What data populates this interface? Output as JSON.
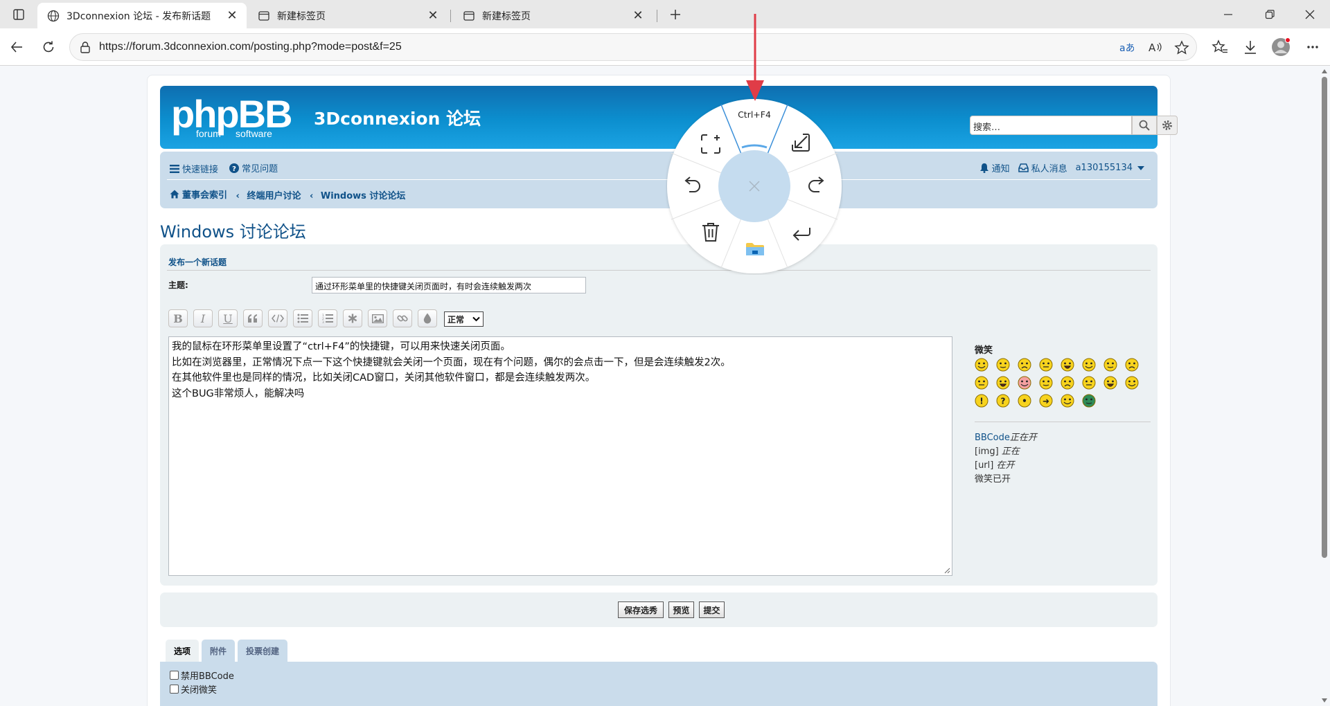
{
  "browser": {
    "tabs": [
      {
        "title": "3Dconnexion 论坛 - 发布新话题",
        "active": true
      },
      {
        "title": "新建标签页",
        "active": false
      },
      {
        "title": "新建标签页",
        "active": false
      }
    ],
    "url": "https://forum.3dconnexion.com/posting.php?mode=post&f=25"
  },
  "header": {
    "logo_text": "phpBB",
    "logo_sub1": "forum",
    "logo_sub2": "software",
    "site_title": "3Dconnexion 论坛",
    "search_placeholder": "搜索…"
  },
  "nav": {
    "quick_links": "快速链接",
    "faq": "常见问题",
    "notifications": "通知",
    "private_messages": "私人消息",
    "username": "a130155134",
    "breadcrumbs": [
      "董事会索引",
      "终端用户讨论",
      "Windows 讨论论坛"
    ]
  },
  "forum_title": "Windows 讨论论坛",
  "posting": {
    "panel_title": "发布一个新话题",
    "subject_label": "主题:",
    "subject_value": "通过环形菜单里的快捷键关闭页面时，有时会连续触发两次",
    "size_select": "正常",
    "message_lines": [
      "我的鼠标在环形菜单里设置了“ctrl+F4”的快捷键，可以用来快速关闭页面。",
      "比如在浏览器里，正常情况下点一下这个快捷键就会关闭一个页面，现在有个问题，偶尔的会点击一下，但是会连续触发2次。",
      "在其他软件里也是同样的情况，比如关闭CAD窗口，关闭其他软件窗口，都是会连续触发两次。",
      "这个BUG非常烦人，能解决吗"
    ],
    "smilies_title": "微笑",
    "bbcode_link": "BBCode",
    "bbcode_status": "正在开",
    "img_label": "[img]",
    "img_status": "正在",
    "url_label": "[url]",
    "url_status": "在开",
    "smilies_label": "微笑已开"
  },
  "buttons": {
    "save": "保存选秀",
    "preview": "预览",
    "submit": "提交"
  },
  "bottom_tabs": [
    "选项",
    "附件",
    "投票创建"
  ],
  "options": {
    "disable_bbcode": "禁用BBCode",
    "disable_smilies": "关闭微笑"
  },
  "radial_menu": {
    "top_label": "Ctrl+F4",
    "segments": [
      "capture-icon",
      "minimize-window-icon",
      "undo-icon",
      "redo-icon",
      "delete-icon",
      "enter-icon",
      "file-explorer-icon",
      "close-icon"
    ]
  },
  "colors": {
    "header_blue": "#0c8fcf",
    "link_blue": "#105289",
    "nav_bg": "#cadceb",
    "panel_bg": "#ecf1f3",
    "radial_center": "#c5dcef",
    "arrow_red": "#e03c47"
  }
}
